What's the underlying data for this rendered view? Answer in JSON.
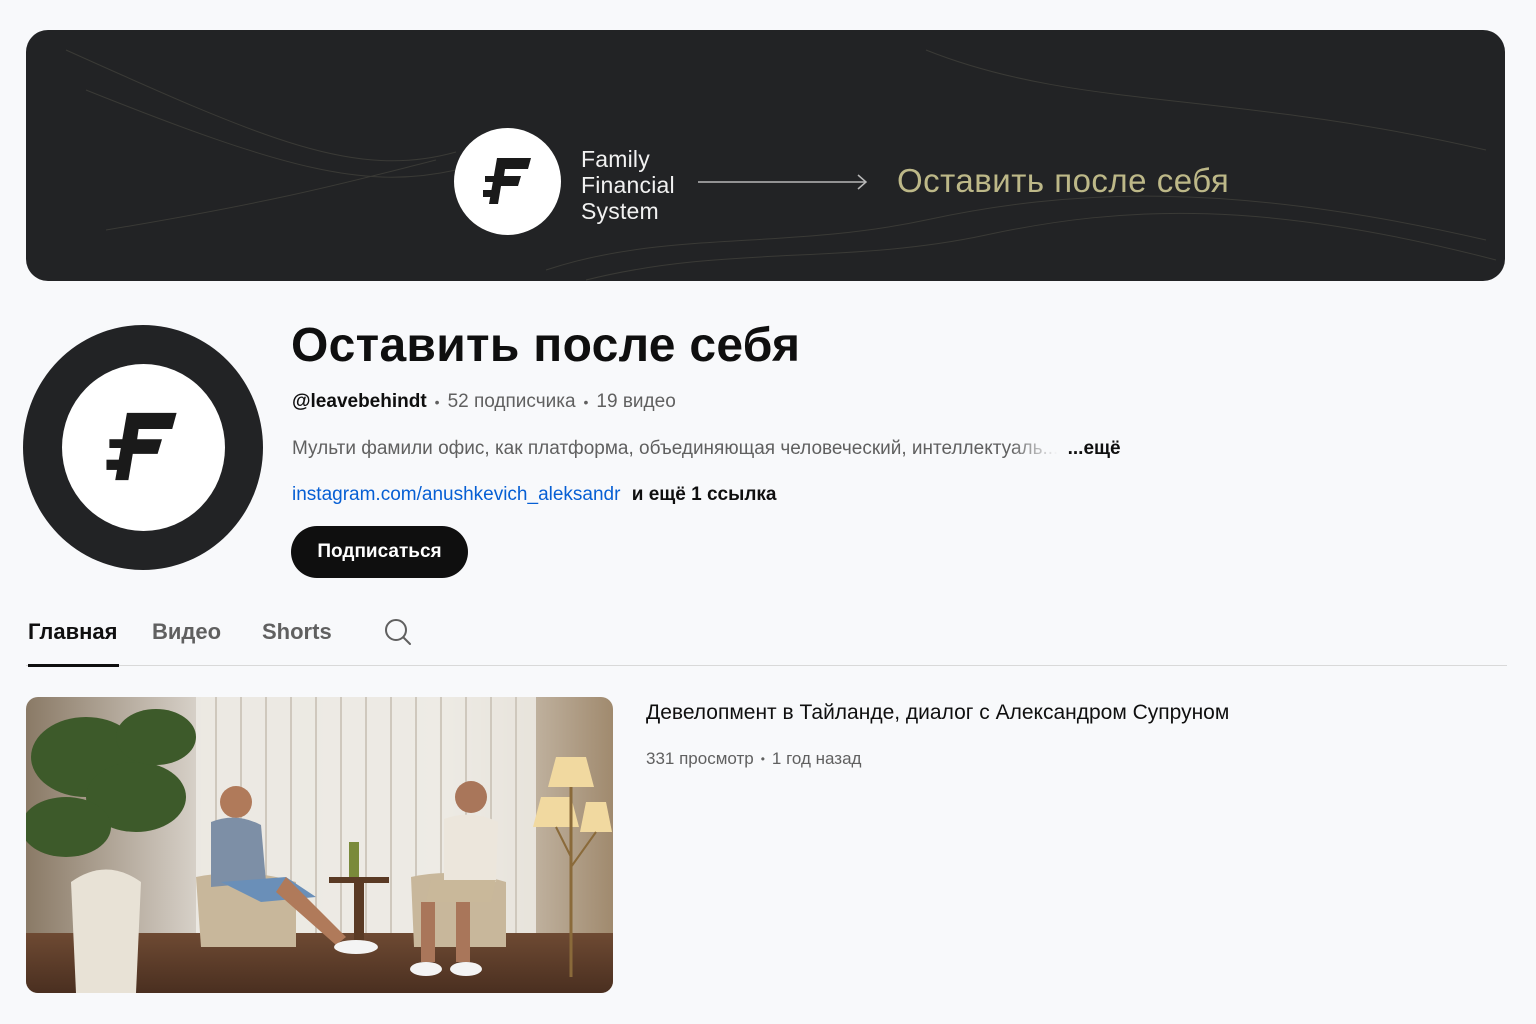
{
  "banner": {
    "brand_name": "Family\nFinancial\nSystem",
    "title": "Оставить после себя",
    "logo_icon": "ffs-logo-icon",
    "accent_color": "#bdb888"
  },
  "channel": {
    "name": "Оставить после себя",
    "handle": "@leavebehindt",
    "subscribers": "52 подписчика",
    "video_count": "19 видео",
    "description": "Мульти фамили офис, как платформа, объединяющая человеческий, интеллекту",
    "description_fade": "аль...",
    "description_more": "...ещё",
    "link": "instagram.com/anushkevich_aleksandr",
    "more_links": "и ещё 1 ссылка",
    "subscribe_label": "Подписаться"
  },
  "tabs": [
    {
      "label": "Главная",
      "active": true
    },
    {
      "label": "Видео",
      "active": false
    },
    {
      "label": "Shorts",
      "active": false
    }
  ],
  "video": {
    "title": "Девелопмент в Тайланде, диалог с Александром Супруном",
    "views": "331 просмотр",
    "age": "1 год назад"
  }
}
